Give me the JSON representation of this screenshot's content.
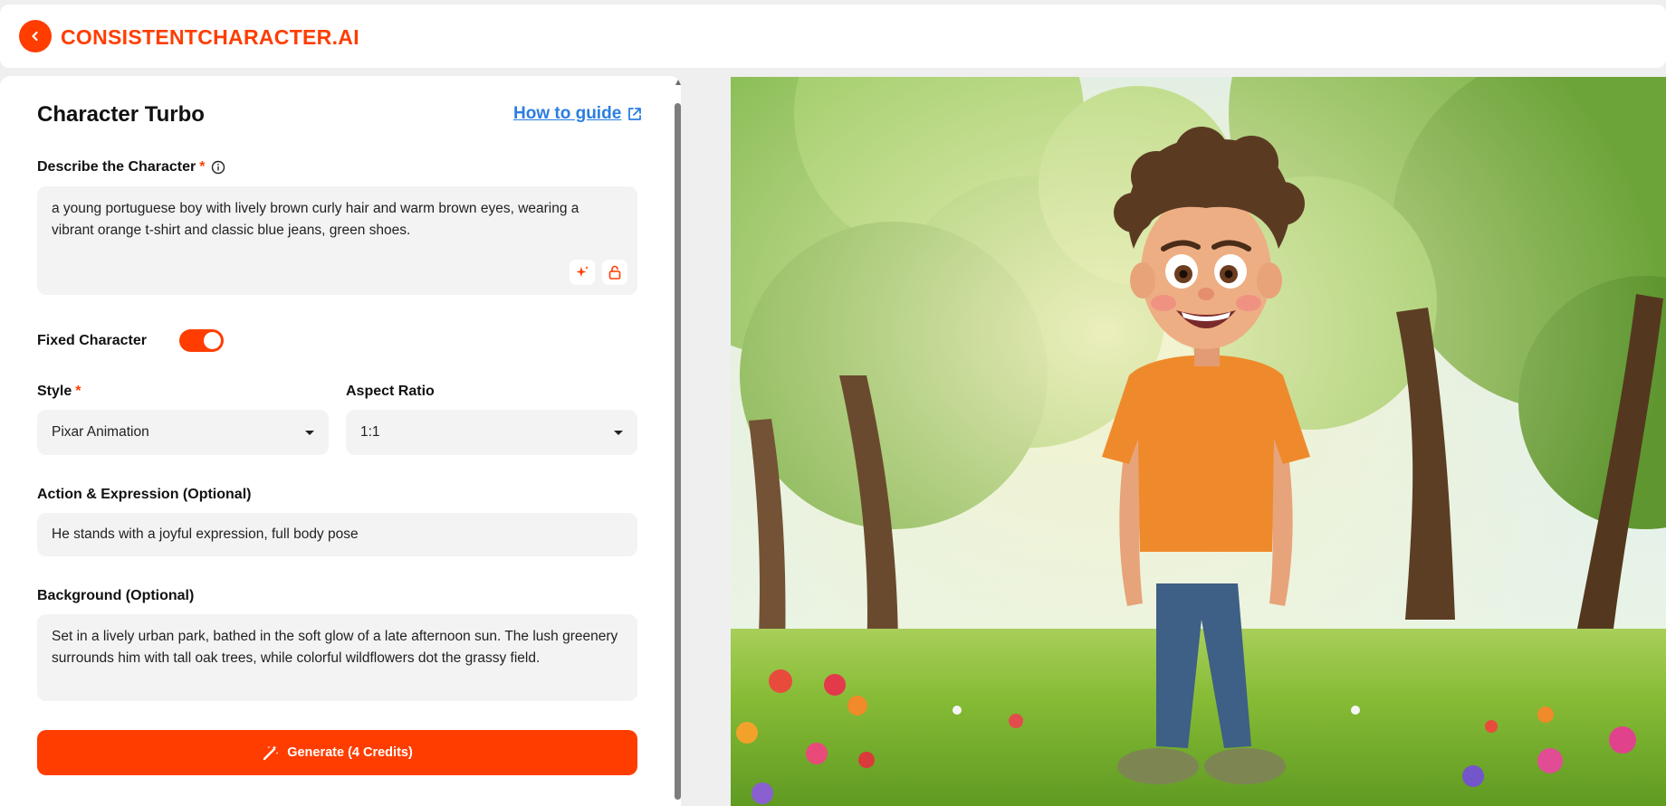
{
  "header": {
    "brand": "CONSISTENTCHARACTER.AI",
    "back_icon": "chevron-left-icon"
  },
  "panel": {
    "title": "Character Turbo",
    "guide_label": "How to guide",
    "guide_icon": "external-link-icon",
    "describe": {
      "label": "Describe the Character",
      "required": "*",
      "info_icon": "info-icon",
      "value": "a young portuguese boy with lively brown curly hair and warm brown eyes, wearing a vibrant orange t-shirt and classic blue jeans, green shoes.",
      "enhance_icon": "sparkle-icon",
      "lock_icon": "unlock-icon"
    },
    "fixed_character": {
      "label": "Fixed Character",
      "enabled": true
    },
    "style": {
      "label": "Style",
      "required": "*",
      "value": "Pixar Animation"
    },
    "aspect_ratio": {
      "label": "Aspect Ratio",
      "value": "1:1"
    },
    "action": {
      "label": "Action & Expression (Optional)",
      "value": "He stands with a joyful expression, full body pose"
    },
    "background": {
      "label": "Background (Optional)",
      "value": "Set in a lively urban park, bathed in the soft glow of a late afternoon sun. The lush greenery surrounds him with tall oak trees, while colorful wildflowers dot the grassy field."
    },
    "generate": {
      "label": "Generate (4 Credits)",
      "icon": "magic-wand-icon"
    }
  },
  "colors": {
    "accent": "#ff3d00",
    "link": "#2a7de1",
    "field_bg": "#f3f3f3"
  }
}
